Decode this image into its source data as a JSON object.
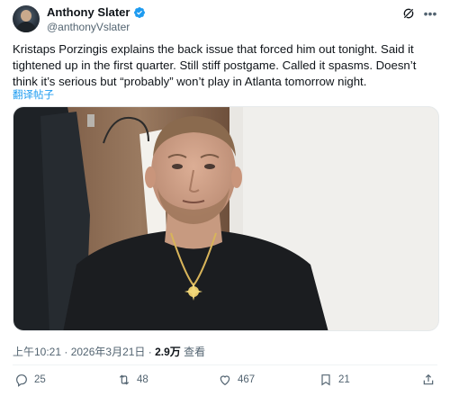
{
  "author": {
    "display_name": "Anthony Slater",
    "handle": "@anthonyVslater",
    "verified_color": "#1d9bf0"
  },
  "tweet": {
    "text": "Kristaps Porzingis explains the back issue that forced him out tonight. Said it tightened up in the first quarter. Still stiff postgame. Called it spasms. Doesn’t think it’s serious but “probably” won’t play in Atlanta tomorrow night.",
    "translate_label": "翻译帖子"
  },
  "meta": {
    "timestamp": "上午10:21 · 2026年3月21日 · ",
    "views": "2.9万",
    "views_suffix": " 查看"
  },
  "actions": {
    "replies": "25",
    "reposts": "48",
    "likes": "467",
    "bookmarks": "21"
  },
  "colors": {
    "accent": "#1d9bf0",
    "muted": "#536471"
  }
}
